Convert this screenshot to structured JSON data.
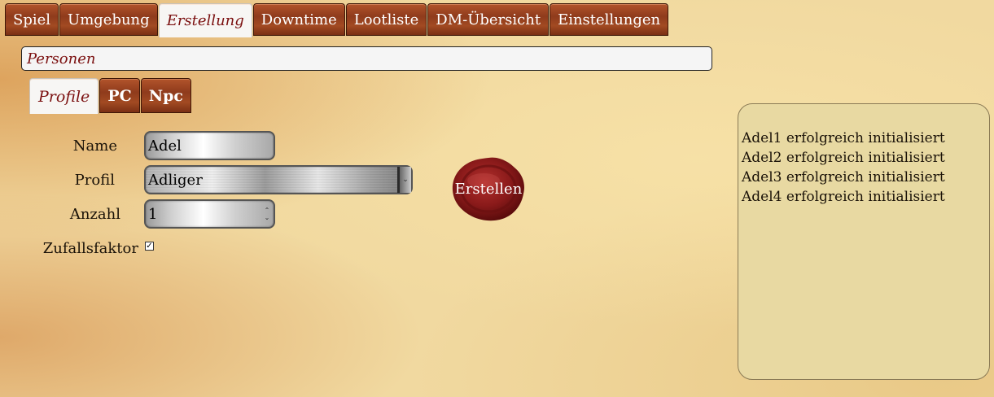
{
  "top_tabs": [
    {
      "label": "Spiel",
      "active": false
    },
    {
      "label": "Umgebung",
      "active": false
    },
    {
      "label": "Erstellung",
      "active": true
    },
    {
      "label": "Downtime",
      "active": false
    },
    {
      "label": "Lootliste",
      "active": false
    },
    {
      "label": "DM-Übersicht",
      "active": false
    },
    {
      "label": "Einstellungen",
      "active": false
    }
  ],
  "section_title": "Personen",
  "sub_tabs": [
    {
      "label": "Profile",
      "active": true
    },
    {
      "label": "PC",
      "active": false
    },
    {
      "label": "Npc",
      "active": false
    }
  ],
  "form": {
    "name_label": "Name",
    "name_value": "Adel",
    "profil_label": "Profil",
    "profil_value": "Adliger",
    "anzahl_label": "Anzahl",
    "anzahl_value": "1",
    "zufall_label": "Zufallsfaktor",
    "zufall_checked": true,
    "create_button": "Erstellen"
  },
  "log_lines": [
    "Adel1 erfolgreich initialisiert",
    "Adel2 erfolgreich initialisiert",
    "Adel3 erfolgreich initialisiert",
    "Adel4 erfolgreich initialisiert"
  ],
  "colors": {
    "accent_text": "#7b1010",
    "wood_tab": "#8f3b1c",
    "log_bg": "#e8d9a2",
    "seal": "#8e1c1c"
  }
}
